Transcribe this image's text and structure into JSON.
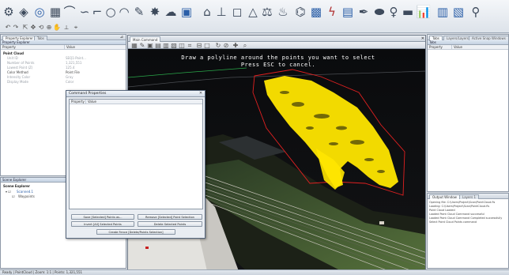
{
  "ribbon": {
    "icons": [
      "settings-icon",
      "shapes-icon",
      "target-icon",
      "grid-icon",
      "line-icon",
      "curve-icon",
      "polyline-icon",
      "circle-icon",
      "arc-icon",
      "brush-icon",
      "gear-icon",
      "cloud-icon",
      "table-icon",
      "house-icon",
      "chart-icon",
      "triangle-icon",
      "scale-icon",
      "network-icon",
      "help-icon",
      "lightning-icon",
      "clipboard-icon",
      "paint-icon",
      "link-icon",
      "key-icon",
      "bar-icon",
      "columns-icon",
      "layers-icon",
      "pages-icon",
      "wrench-icon"
    ]
  },
  "left_panel": {
    "tabs": [
      "Property Explorer",
      "Tabs"
    ],
    "title": "Property Explorer",
    "headers": {
      "property": "Property",
      "value": "Value"
    },
    "section": "Point Cloud",
    "rows": [
      {
        "label": "Unit ID",
        "value": "SEQ1-Point..."
      },
      {
        "label": "Number of Points",
        "value": "1,321,551"
      },
      {
        "label": "Lowest Point (Z)",
        "value": "125.4"
      },
      {
        "label": "Color Method",
        "value": "Point File"
      },
      {
        "label": "Intensity Color",
        "value": "Gray"
      },
      {
        "label": "Display Mode",
        "value": "Color"
      }
    ]
  },
  "scene_panel": {
    "title": "Scene Explorer",
    "label": "Scene Explorer",
    "items": [
      "Scanned.1",
      "Waypoints"
    ]
  },
  "viewport": {
    "tab": "Main Command",
    "prompt_line1": "Draw a polyline around the points you want to select",
    "prompt_line2": "Press ESC to cancel."
  },
  "dialog": {
    "title": "Command Properties",
    "headers": {
      "property": "Property",
      "value": "Value"
    },
    "buttons": {
      "save_selected": "Save [Selected] Points as...",
      "remove_selected": "Remove [Selected] Point Selection",
      "invert": "Invert [All] Selected Points",
      "delete": "Delete Selected Points",
      "create_fence": "Create Fence [Delete/Points Selection]"
    }
  },
  "right_panel": {
    "tabs": [
      "Tabs",
      "Layers/Layers",
      "Active Snap Windows"
    ],
    "title": "Tabs",
    "headers": {
      "property": "Property",
      "value": "Value"
    }
  },
  "output_panel": {
    "tabs": [
      "Output Window",
      "Layers 1"
    ],
    "lines": [
      "Opening file: C:\\Users\\Project\\Scan\\PointCloud.fls",
      "Loading: C:\\Users\\Project\\Scan\\PointCloud.fls",
      "Point Cloud Loaded",
      "Loaded Point Cloud Command successful",
      "Loaded Point Cloud Command Completed successfully",
      "Select Point Cloud Points command"
    ]
  },
  "statusbar": {
    "text": "Ready | PointCloud | Zoom: 1:1 | Points: 1,321,551"
  },
  "colors": {
    "selection": "#ffe600",
    "polyline": "#e02020",
    "grass": "#7a9a4c",
    "background": "#0d0d0f"
  }
}
